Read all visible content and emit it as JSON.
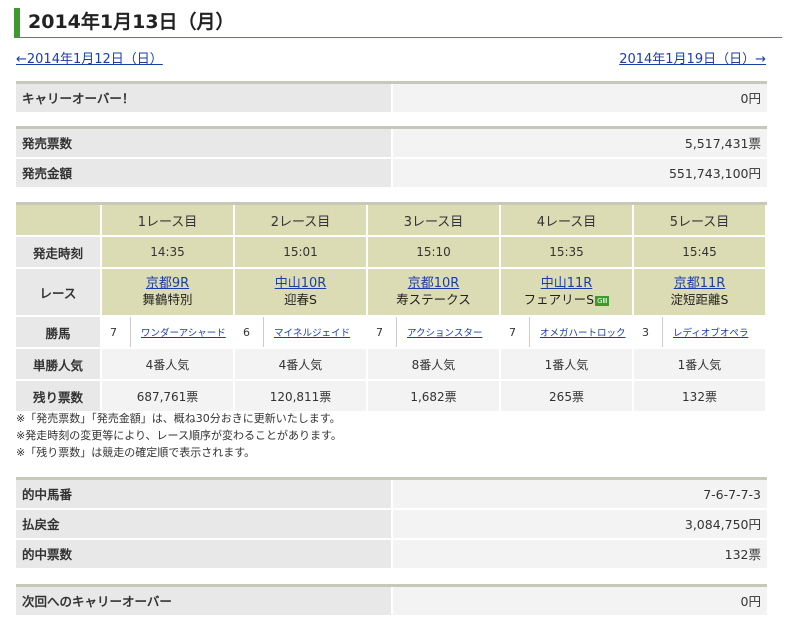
{
  "title": "2014年1月13日（月）",
  "nav": {
    "prev": "←2014年1月12日（日）",
    "next": "2014年1月19日（日）→"
  },
  "carryover": {
    "label": "キャリーオーバー！",
    "value": "0円"
  },
  "sales": [
    {
      "label": "発売票数",
      "value": "5,517,431票"
    },
    {
      "label": "発売金額",
      "value": "551,743,100円"
    }
  ],
  "race_table": {
    "race_headers": [
      "1レース目",
      "2レース目",
      "3レース目",
      "4レース目",
      "5レース目"
    ],
    "row_labels": {
      "start_time": "発走時刻",
      "race": "レース",
      "winner": "勝馬",
      "popularity": "単勝人気",
      "remaining": "残り票数"
    },
    "start_times": [
      "14:35",
      "15:01",
      "15:10",
      "15:35",
      "15:45"
    ],
    "races": [
      {
        "link": "京都9R",
        "name": "舞鶴特別",
        "grade": ""
      },
      {
        "link": "中山10R",
        "name": "迎春S",
        "grade": ""
      },
      {
        "link": "京都10R",
        "name": "寿ステークス",
        "grade": ""
      },
      {
        "link": "中山11R",
        "name": "フェアリーS",
        "grade": "GⅢ"
      },
      {
        "link": "京都11R",
        "name": "淀短距離S",
        "grade": ""
      }
    ],
    "winners": [
      {
        "num": "7",
        "name": "ワンダーアシャード"
      },
      {
        "num": "6",
        "name": "マイネルジェイド"
      },
      {
        "num": "7",
        "name": "アクションスター"
      },
      {
        "num": "7",
        "name": "オメガハートロック"
      },
      {
        "num": "3",
        "name": "レディオブオペラ"
      }
    ],
    "popularity": [
      "4番人気",
      "4番人気",
      "8番人気",
      "1番人気",
      "1番人気"
    ],
    "remaining": [
      "687,761票",
      "120,811票",
      "1,682票",
      "265票",
      "132票"
    ]
  },
  "notes": [
    "※「発売票数」「発売金額」は、概ね30分おきに更新いたします。",
    "※発走時刻の変更等により、レース順序が変わることがあります。",
    "※「残り票数」は競走の確定順で表示されます。"
  ],
  "results": [
    {
      "label": "的中馬番",
      "value": "7-6-7-7-3"
    },
    {
      "label": "払戻金",
      "value": "3,084,750円"
    },
    {
      "label": "的中票数",
      "value": "132票"
    }
  ],
  "next_carryover": {
    "label": "次回へのキャリーオーバー",
    "value": "0円"
  }
}
